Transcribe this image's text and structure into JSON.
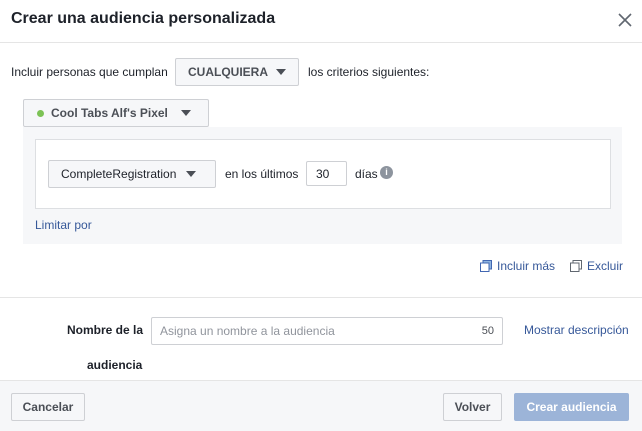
{
  "dialog": {
    "title": "Crear una audiencia personalizada",
    "close_icon": "close-icon"
  },
  "criteria": {
    "prefix": "Incluir personas que cumplan",
    "match_value": "CUALQUIERA",
    "suffix": "los criterios siguientes:"
  },
  "pixel": {
    "name": "Cool Tabs Alf's Pixel",
    "status_color": "#7cc255"
  },
  "rule": {
    "event": "CompleteRegistration",
    "in_last_label": "en los últimos",
    "days_value": "30",
    "days_unit": "días",
    "info_icon": "info-icon",
    "limit_link": "Limitar por"
  },
  "rule_actions": {
    "include_more": "Incluir más",
    "exclude": "Excluir"
  },
  "audience_name": {
    "label_line1": "Nombre de la",
    "label_line2": "audiencia",
    "placeholder": "Asigna un nombre a la audiencia",
    "char_limit": "50",
    "show_description": "Mostrar descripción"
  },
  "footer": {
    "cancel": "Cancelar",
    "back": "Volver",
    "create": "Crear audiencia"
  },
  "colors": {
    "link": "#365899",
    "create_disabled": "#9cb4d8"
  }
}
